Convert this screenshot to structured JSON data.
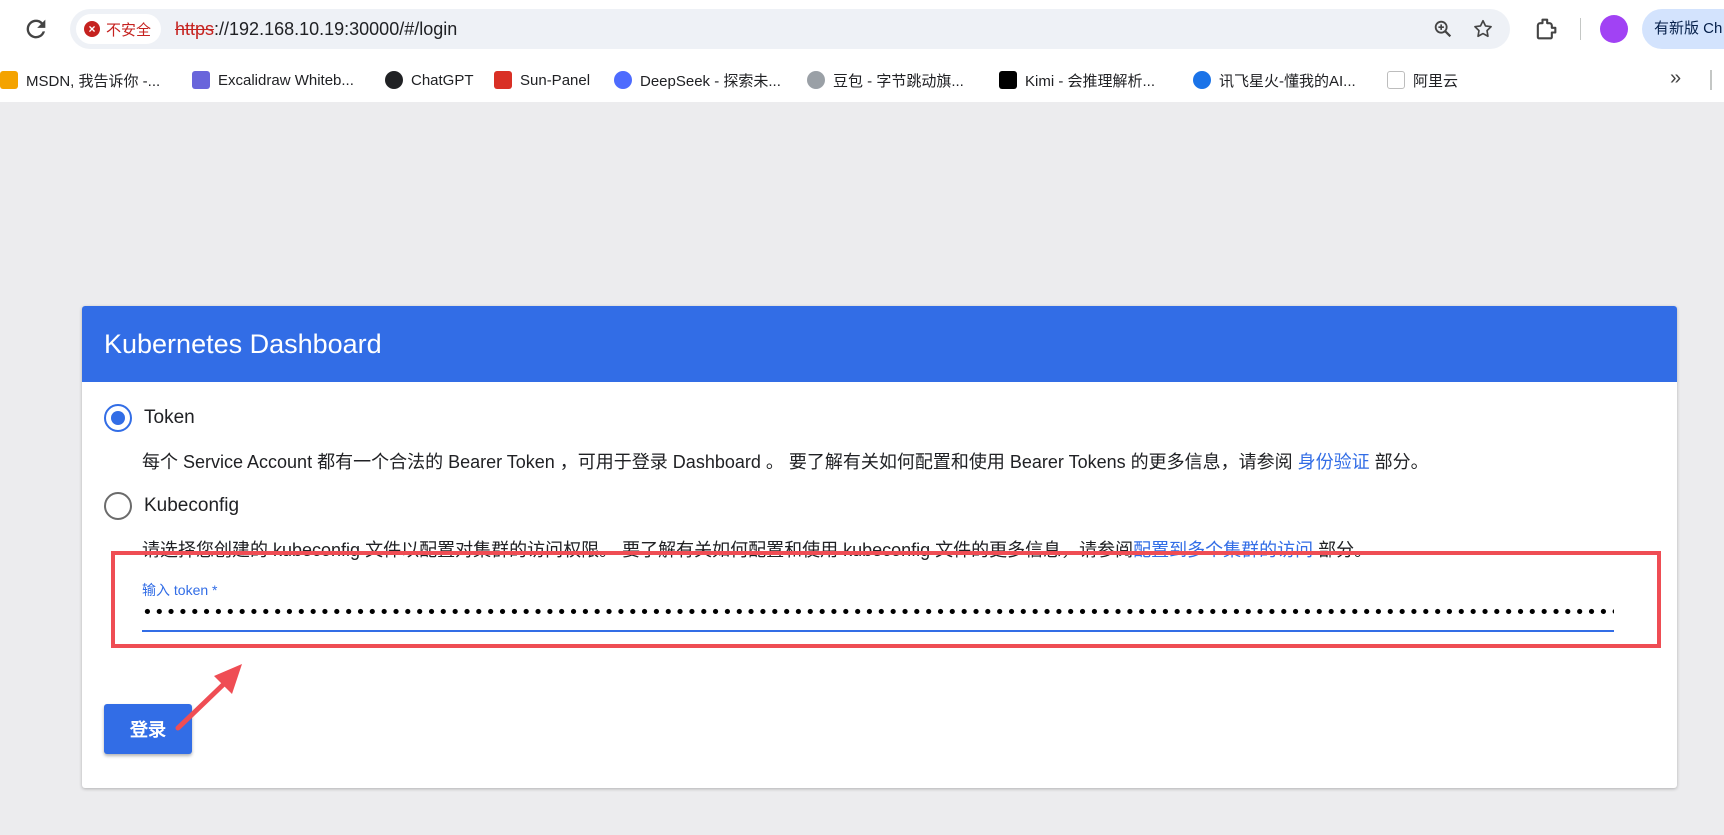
{
  "browser": {
    "security_label": "不安全",
    "url_scheme": "https",
    "url_rest": "://192.168.10.19:30000/#/login",
    "update_label": "有新版 Ch",
    "bookmarks": [
      {
        "label": "MSDN, 我告诉你 -...",
        "icon": "msdn-icon",
        "color": "#f4a300"
      },
      {
        "label": "Excalidraw Whiteb...",
        "icon": "excalidraw-icon",
        "color": "#6965db"
      },
      {
        "label": "ChatGPT",
        "icon": "chatgpt-icon",
        "color": "#202124"
      },
      {
        "label": "Sun-Panel",
        "icon": "sun-panel-icon",
        "color": "#d93025"
      },
      {
        "label": "DeepSeek - 探索未...",
        "icon": "deepseek-icon",
        "color": "#4d6bfe"
      },
      {
        "label": "豆包 - 字节跳动旗...",
        "icon": "doubao-icon",
        "color": "#9aa0a6"
      },
      {
        "label": "Kimi - 会推理解析...",
        "icon": "kimi-icon",
        "color": "#000000"
      },
      {
        "label": "讯飞星火-懂我的AI...",
        "icon": "xunfei-icon",
        "color": "#1a73e8"
      },
      {
        "label": "阿里云",
        "icon": "aliyun-icon",
        "color": "#bdbdbd"
      }
    ]
  },
  "card": {
    "title": "Kubernetes Dashboard",
    "token_option": {
      "label": "Token",
      "selected": true,
      "desc_before": "每个 Service Account 都有一个合法的 Bearer Token ，可用于登录 Dashboard 。 要了解有关如何配置和使用 Bearer Tokens 的更多信息，请参阅 ",
      "desc_link": "身份验证",
      "desc_after": " 部分。"
    },
    "kubeconfig_option": {
      "label": "Kubeconfig",
      "selected": false,
      "desc_before": "请选择您创建的 kubeconfig 文件以配置对集群的访问权限。 要了解有关如何配置和使用 kubeconfig 文件的更多信息，请参阅",
      "desc_link": "配置到多个集群的访问",
      "desc_after": " 部分。"
    },
    "token_field": {
      "label": "输入 token *",
      "value": "••••••••••••••••••••••••••••••••••••••••••••••••••••••••••••••••••••••••••••••••••••••••••••••••••••••••••••••••••••••••••••••••••••••••••••••••••••••••••••••••••••••••"
    },
    "login_label": "登录"
  },
  "colors": {
    "accent": "#326de6",
    "annotation": "#ef4d54",
    "insecure": "#c5221f"
  }
}
